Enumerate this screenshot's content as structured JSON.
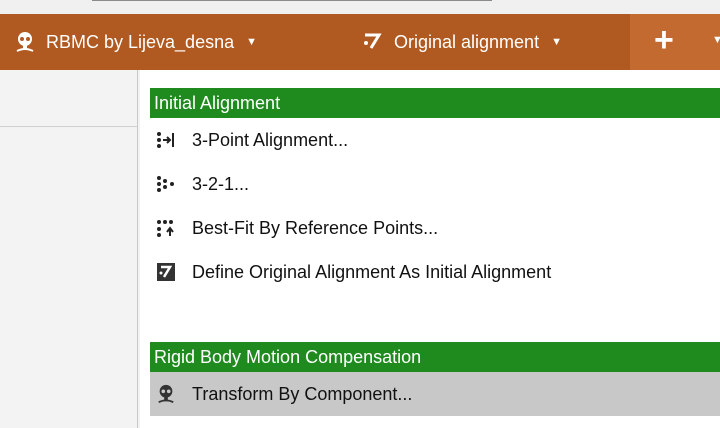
{
  "toolbar": {
    "component_selector": "RBMC by Lijeva_desna",
    "alignment_selector": "Original alignment"
  },
  "menu": {
    "section_initial": "Initial Alignment",
    "items_initial": [
      {
        "label": "3-Point Alignment...",
        "icon": "three-point-alignment-icon"
      },
      {
        "label": "3-2-1...",
        "icon": "three-two-one-icon"
      },
      {
        "label": "Best-Fit By Reference Points...",
        "icon": "best-fit-icon"
      },
      {
        "label": "Define Original Alignment As Initial Alignment",
        "icon": "define-alignment-icon"
      }
    ],
    "section_rbmc": "Rigid Body Motion Compensation",
    "items_rbmc": [
      {
        "label": "Transform By Component...",
        "icon": "transform-component-icon",
        "highlighted": true
      }
    ]
  },
  "colors": {
    "toolbar": "#b05a21",
    "section_header": "#1f8b1f",
    "highlight": "#c8c8c8"
  }
}
